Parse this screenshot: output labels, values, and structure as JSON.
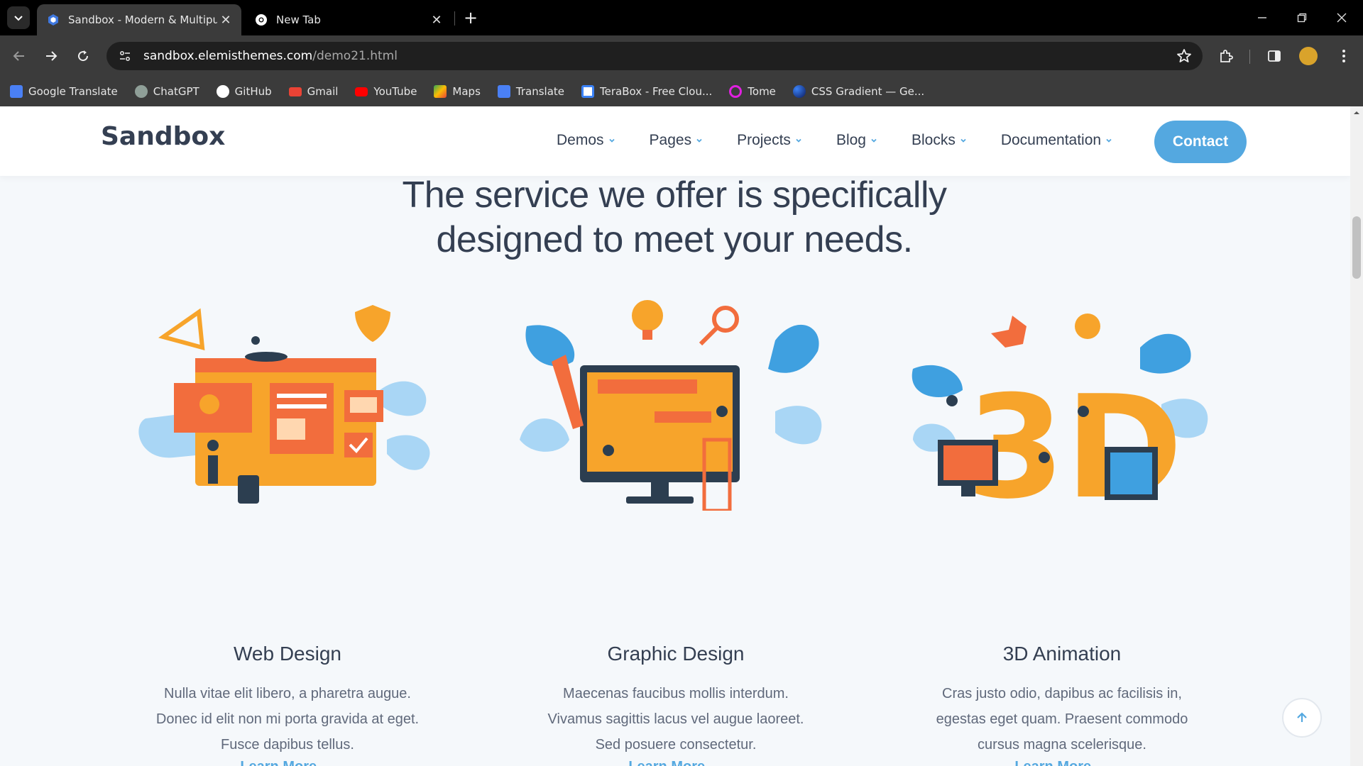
{
  "browser": {
    "tabs": [
      {
        "title": "Sandbox - Modern & Multipurp",
        "active": true
      },
      {
        "title": "New Tab",
        "active": false
      }
    ],
    "url_host": "sandbox.elemisthemes.com",
    "url_path": "/demo21.html",
    "bookmarks": [
      {
        "label": "Google Translate",
        "icon": "google-translate-icon",
        "color": "#4a80f5"
      },
      {
        "label": "ChatGPT",
        "icon": "chatgpt-icon",
        "color": "#8f9f98"
      },
      {
        "label": "GitHub",
        "icon": "github-icon",
        "color": "#ffffff"
      },
      {
        "label": "Gmail",
        "icon": "gmail-icon",
        "color": "#ea4335"
      },
      {
        "label": "YouTube",
        "icon": "youtube-icon",
        "color": "#ff0000"
      },
      {
        "label": "Maps",
        "icon": "maps-icon",
        "color": "#34a853"
      },
      {
        "label": "Translate",
        "icon": "translate-icon",
        "color": "#4a80f5"
      },
      {
        "label": "TeraBox - Free Clou...",
        "icon": "terabox-icon",
        "color": "#3b82f6"
      },
      {
        "label": "Tome",
        "icon": "tome-icon",
        "color": "#e020e0"
      },
      {
        "label": "CSS Gradient — Ge...",
        "icon": "css-gradient-icon",
        "color": "#1f4ed8"
      }
    ]
  },
  "site": {
    "logo": "Sandbox",
    "menu": [
      "Demos",
      "Pages",
      "Projects",
      "Blog",
      "Blocks",
      "Documentation"
    ],
    "contact": "Contact",
    "accent": "#54a8e0",
    "headline_line1": "The service we offer is specifically",
    "headline_line2": "designed to meet your needs.",
    "cards": [
      {
        "title": "Web Design",
        "text_lines": [
          "Nulla vitae elit libero, a pharetra augue.",
          "Donec id elit non mi porta gravida at eget.",
          "Fusce dapibus tellus."
        ],
        "link": "Learn More →"
      },
      {
        "title": "Graphic Design",
        "text_lines": [
          "Maecenas faucibus mollis interdum.",
          "Vivamus sagittis lacus vel augue laoreet.",
          "Sed posuere consectetur."
        ],
        "link": "Learn More →"
      },
      {
        "title": "3D Animation",
        "text_lines": [
          "Cras justo odio, dapibus ac facilisis in,",
          "egestas eget quam. Praesent commodo",
          "cursus magna scelerisque."
        ],
        "link": "Learn More →"
      }
    ]
  }
}
